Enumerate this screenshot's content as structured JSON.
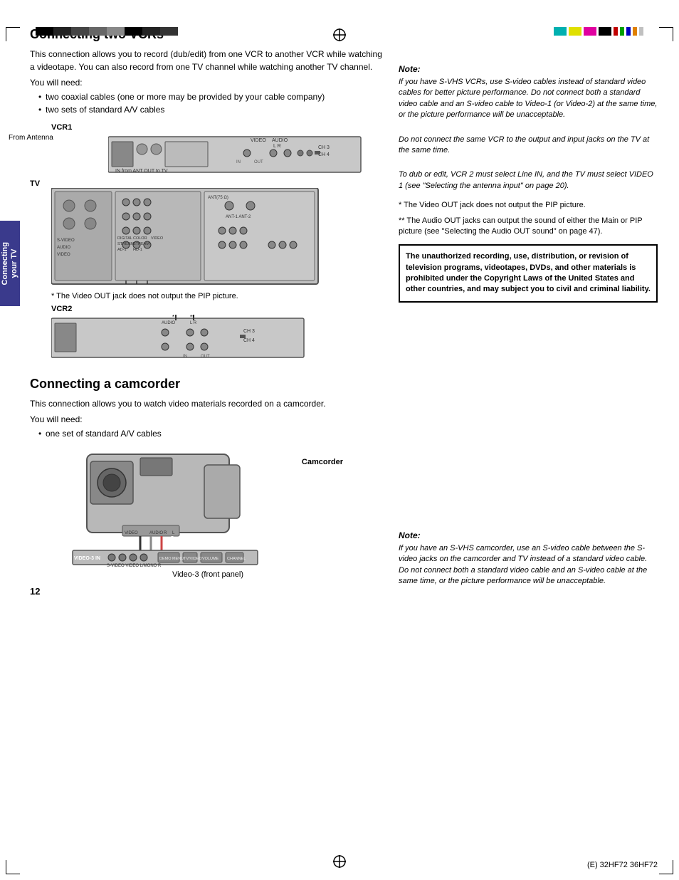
{
  "page": {
    "number": "12",
    "footer_model": "(E) 32HF72  36HF72"
  },
  "sidebar": {
    "line1": "Connecting",
    "line2": "your TV"
  },
  "section1": {
    "title": "Connecting two VCRs",
    "body1": "This connection allows you to record (dub/edit) from one VCR to another VCR while watching a videotape. You can also record from one TV channel while watching another TV channel.",
    "you_will_need": "You will need:",
    "bullets": [
      "two coaxial cables (one or more may be provided by your cable company)",
      "two sets of standard A/V cables"
    ],
    "vcr1_label": "VCR1",
    "vcr2_label": "VCR2",
    "tv_label": "TV",
    "from_antenna": "From Antenna",
    "asterisk_note1": "*  The Video OUT jack does not output the PIP picture.",
    "asterisk_note2": "**  The Audio OUT jacks can output the sound of either the Main or PIP picture (see \"Selecting the Audio OUT sound\" on page 47)."
  },
  "section2": {
    "title": "Connecting a camcorder",
    "body1": "This connection allows you to watch video materials recorded on a camcorder.",
    "you_will_need": "You will need:",
    "bullets": [
      "one set of standard A/V cables"
    ],
    "camcorder_label": "Camcorder",
    "video3_label": "Video-3 (front panel)"
  },
  "note1": {
    "title": "Note:",
    "lines": [
      "If you have S-VHS VCRs, use S-video cables instead of standard video cables for better picture performance. Do not connect both a standard video cable and an S-video cable to Video-1 (or Video-2) at the same time, or the picture performance will be unacceptable.",
      "Do not connect the same VCR to the output and input jacks on the TV at the same time.",
      "To dub or edit, VCR 2 must select Line IN, and the TV must select VIDEO 1 (see \"Selecting the antenna input\" on page 20)."
    ]
  },
  "copyright": {
    "text": "The unauthorized recording, use, distribution, or revision of television programs, videotapes, DVDs, and other materials is prohibited under the Copyright Laws of the United States and other countries, and may subject you to civil and criminal liability."
  },
  "note2": {
    "title": "Note:",
    "text": "If you have an S-VHS camcorder, use an S-video cable between the S-video jacks on the camcorder and TV instead of a standard video cable. Do not connect both a standard video cable and an S-video cable at the same time, or the picture performance will be unacceptable."
  },
  "colors": {
    "sidebar_bg": "#3a3a8c",
    "border_dark": "#333333",
    "diagram_bg": "#cccccc",
    "note_border": "#000000"
  }
}
